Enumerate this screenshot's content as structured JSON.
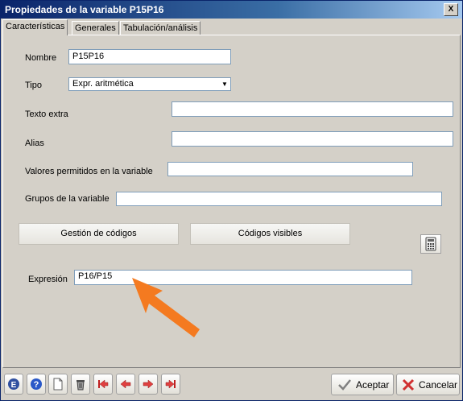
{
  "window": {
    "title": "Propiedades de la variable P15P16",
    "close_label": "X"
  },
  "tabs": [
    {
      "label": "Características"
    },
    {
      "label": "Generales"
    },
    {
      "label": "Tabulación/análisis"
    }
  ],
  "form": {
    "nombre_label": "Nombre",
    "nombre_value": "P15P16",
    "tipo_label": "Tipo",
    "tipo_value": "Expr. aritmética",
    "texto_extra_label": "Texto extra",
    "texto_extra_value": "",
    "alias_label": "Alias",
    "alias_value": "",
    "valores_label": "Valores permitidos en la variable",
    "valores_value": "",
    "grupos_label": "Grupos de la variable",
    "grupos_value": "",
    "gestion_button": "Gestión de códigos",
    "codigos_button": "Códigos visibles",
    "expresion_label": "Expresión",
    "expresion_value": "P16/P15"
  },
  "footer": {
    "aceptar": "Aceptar",
    "cancelar": "Cancelar"
  },
  "annotation": {
    "arrow_color": "#f47a20"
  }
}
